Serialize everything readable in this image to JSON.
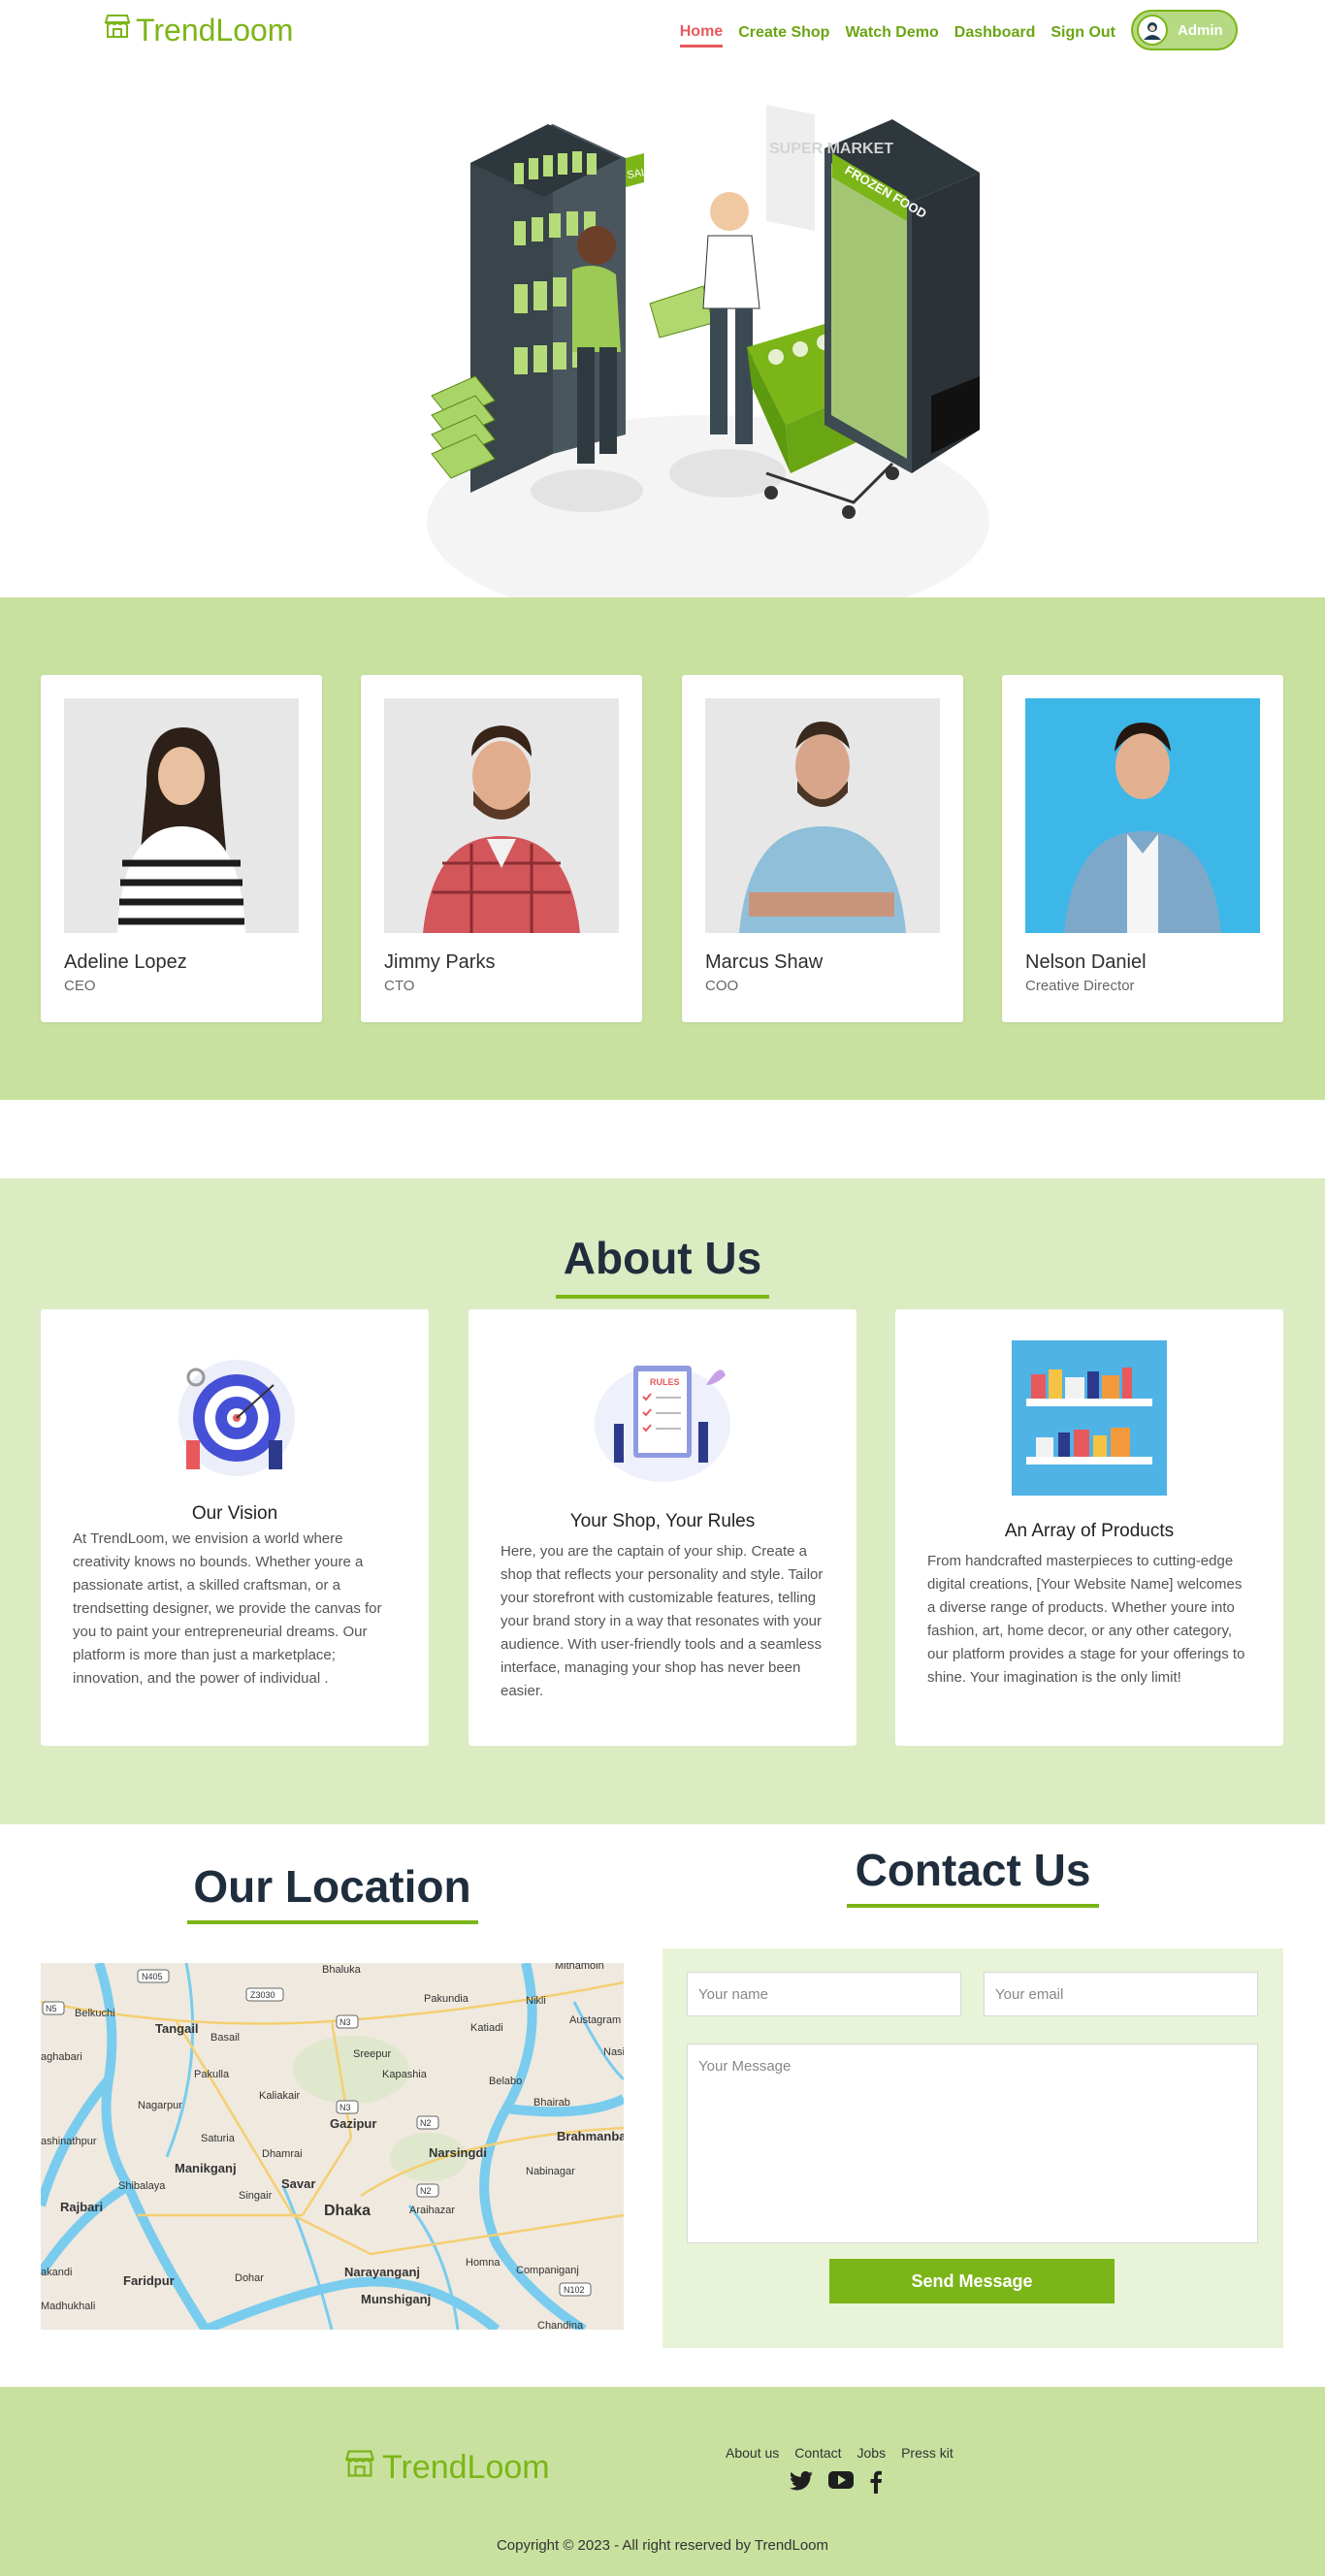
{
  "brand": {
    "name": "TrendLoom",
    "color": "#7cb518",
    "icon": "storefront-icon"
  },
  "nav": {
    "items": [
      {
        "label": "Home",
        "active": true
      },
      {
        "label": "Create Shop",
        "active": false
      },
      {
        "label": "Watch Demo",
        "active": false
      },
      {
        "label": "Dashboard",
        "active": false
      },
      {
        "label": "Sign Out",
        "active": false
      }
    ],
    "admin_label": "Admin"
  },
  "hero": {
    "sign_sale": "SALE",
    "sign_frozen": "FROZEN FOOD",
    "sign_market": "SUPER MARKET"
  },
  "team": [
    {
      "name": "Adeline Lopez",
      "role": "CEO"
    },
    {
      "name": "Jimmy Parks",
      "role": "CTO"
    },
    {
      "name": "Marcus Shaw",
      "role": "COO"
    },
    {
      "name": "Nelson Daniel",
      "role": "Creative Director"
    }
  ],
  "about": {
    "title": "About Us",
    "cards": [
      {
        "title": "Our Vision",
        "text": "At TrendLoom, we envision a world where creativity knows no bounds. Whether youre a passionate artist, a skilled craftsman, or a trendsetting designer, we provide the canvas for you to paint your entrepreneurial dreams. Our platform is more than just a marketplace; innovation, and the power of individual ."
      },
      {
        "title": "Your Shop, Your Rules",
        "text": "Here, you are the captain of your ship. Create a shop that reflects your personality and style. Tailor your storefront with customizable features, telling your brand story in a way that resonates with your audience. With user-friendly tools and a seamless interface, managing your shop has never been easier.",
        "illustration_label": "RULES"
      },
      {
        "title": "An Array of Products",
        "text": "From handcrafted masterpieces to cutting-edge digital creations, [Your Website Name] welcomes a diverse range of products. Whether youre into fashion, art, home decor, or any other category, our platform provides a stage for your offerings to shine. Your imagination is the only limit!"
      }
    ]
  },
  "location": {
    "title": "Our Location",
    "map_labels": [
      "Bhaluka",
      "Mithamoin",
      "Tangail",
      "Basail",
      "Pakundia",
      "Nikli",
      "Austagram",
      "Belkuchi",
      "Kaliakair",
      "Sreepur",
      "Katiadi",
      "Nasi",
      "aghabari",
      "Pakulla",
      "Kapashia",
      "Belabo",
      "Nagarpur",
      "Gazipur",
      "Bhairab",
      "shinathpur",
      "Saturia",
      "Dhamrai",
      "Narsingdi",
      "Brahmanba",
      "Manikganj",
      "Shibalaya",
      "Savar",
      "Singair",
      "Nabinagar",
      "Rajbari",
      "Dhaka",
      "Araihazar",
      "akandi",
      "Faridpur",
      "Dohar",
      "Homna",
      "Narayanganj",
      "Companiganj",
      "Madhukhali",
      "Munshiganj",
      "Chandina"
    ],
    "road_labels": [
      "N405",
      "Z3030",
      "N5",
      "N3",
      "N2",
      "N102"
    ]
  },
  "contact": {
    "title": "Contact Us",
    "name_placeholder": "Your name",
    "email_placeholder": "Your email",
    "message_placeholder": "Your Message",
    "send_label": "Send Message"
  },
  "footer": {
    "brand": "TrendLoom",
    "links": [
      "About us",
      "Contact",
      "Jobs",
      "Press kit"
    ],
    "social_icons": [
      "twitter-icon",
      "youtube-icon",
      "facebook-icon"
    ],
    "copyright": "Copyright © 2023 - All right reserved by TrendLoom"
  }
}
